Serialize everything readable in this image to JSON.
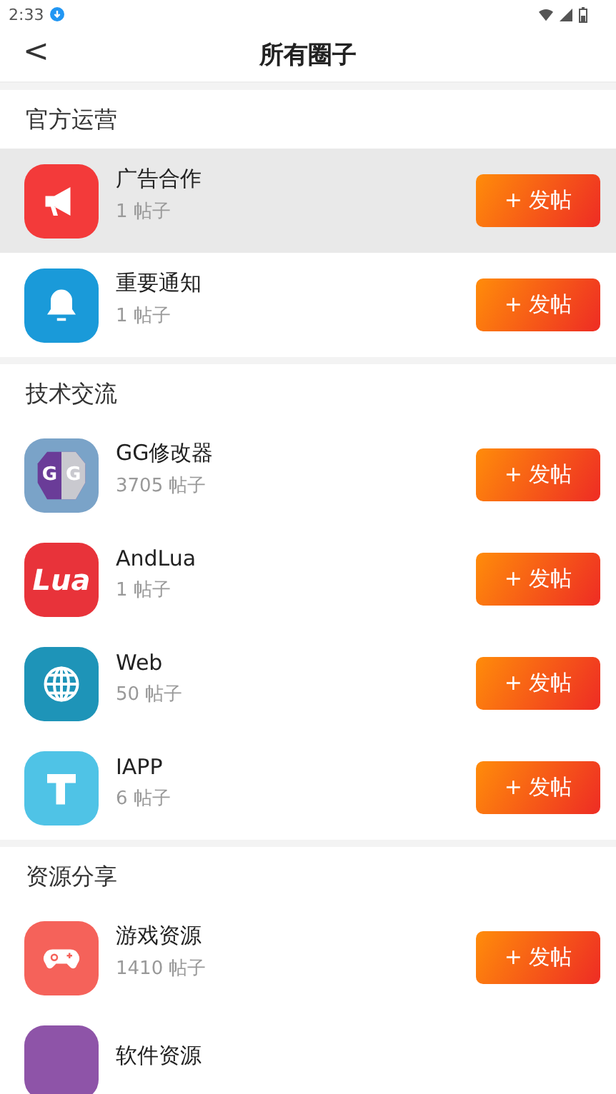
{
  "status_bar": {
    "time": "2:33"
  },
  "header": {
    "back": "<",
    "title": "所有圈子"
  },
  "sections": [
    {
      "title": "官方运营",
      "items": [
        {
          "name": "广告合作",
          "count": "1 帖子",
          "kind": "megaphone",
          "color": "#f33a3a",
          "selected": true,
          "button": "+ 发帖"
        },
        {
          "name": "重要通知",
          "count": "1 帖子",
          "kind": "bell",
          "color": "#1a9ad9",
          "selected": false,
          "button": "+ 发帖"
        }
      ]
    },
    {
      "title": "技术交流",
      "items": [
        {
          "name": "GG修改器",
          "count": "3705 帖子",
          "kind": "shield",
          "color": "#7aa3c8",
          "icon_text": "GG",
          "selected": false,
          "button": "+ 发帖"
        },
        {
          "name": "AndLua",
          "count": "1 帖子",
          "kind": "logo",
          "color": "#e8333a",
          "icon_text": "Lua",
          "selected": false,
          "button": "+ 发帖"
        },
        {
          "name": "Web",
          "count": "50 帖子",
          "kind": "globe",
          "color": "#1e94b8",
          "selected": false,
          "button": "+ 发帖"
        },
        {
          "name": "IAPP",
          "count": "6 帖子",
          "kind": "info",
          "color": "#4fc3e6",
          "selected": false,
          "button": "+ 发帖"
        }
      ]
    },
    {
      "title": "资源分享",
      "items": [
        {
          "name": "游戏资源",
          "count": "1410 帖子",
          "kind": "gamepad",
          "color": "#f5625a",
          "selected": false,
          "button": "+ 发帖"
        },
        {
          "name": "软件资源",
          "kind": "plain",
          "color": "#8e54a8",
          "selected": false
        }
      ]
    }
  ]
}
